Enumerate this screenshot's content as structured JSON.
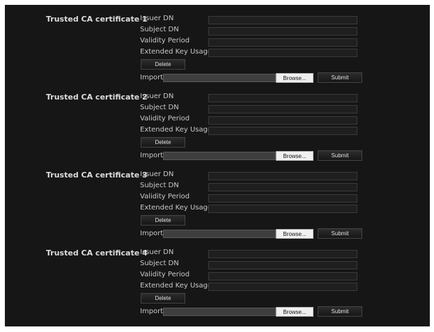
{
  "certificates": [
    {
      "title": "Trusted CA certificate 1",
      "issuer_label": "Issuer DN",
      "issuer_value": "",
      "subject_label": "Subject DN",
      "subject_value": "",
      "validity_label": "Validity Period",
      "validity_value": "",
      "eku_label": "Extended Key Usage",
      "eku_value": "",
      "delete_label": "Delete",
      "import_label": "Import",
      "browse_label": "Browse...",
      "submit_label": "Submit"
    },
    {
      "title": "Trusted CA certificate 2",
      "issuer_label": "Issuer DN",
      "issuer_value": "",
      "subject_label": "Subject DN",
      "subject_value": "",
      "validity_label": "Validity Period",
      "validity_value": "",
      "eku_label": "Extended Key Usage",
      "eku_value": "",
      "delete_label": "Delete",
      "import_label": "Import",
      "browse_label": "Browse...",
      "submit_label": "Submit"
    },
    {
      "title": "Trusted CA certificate 3",
      "issuer_label": "Issuer DN",
      "issuer_value": "",
      "subject_label": "Subject DN",
      "subject_value": "",
      "validity_label": "Validity Period",
      "validity_value": "",
      "eku_label": "Extended Key Usage",
      "eku_value": "",
      "delete_label": "Delete",
      "import_label": "Import",
      "browse_label": "Browse...",
      "submit_label": "Submit"
    },
    {
      "title": "Trusted CA certificate 4",
      "issuer_label": "Issuer DN",
      "issuer_value": "",
      "subject_label": "Subject DN",
      "subject_value": "",
      "validity_label": "Validity Period",
      "validity_value": "",
      "eku_label": "Extended Key Usage",
      "eku_value": "",
      "delete_label": "Delete",
      "import_label": "Import",
      "browse_label": "Browse...",
      "submit_label": "Submit"
    }
  ]
}
